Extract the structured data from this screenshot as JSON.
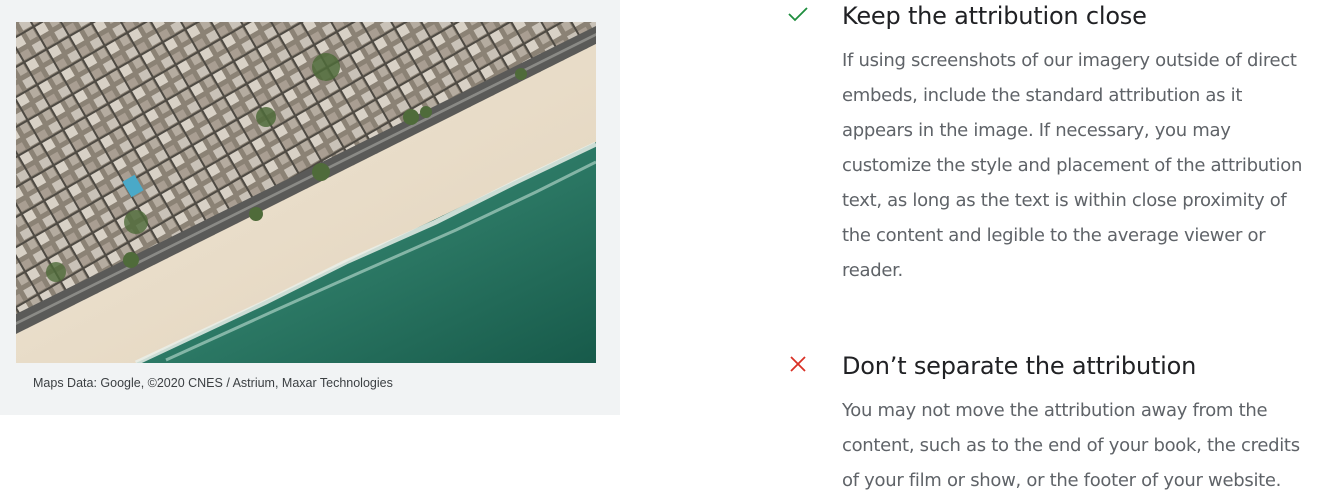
{
  "figure": {
    "image_alt": "Aerial photo of a beach with ocean and city buildings",
    "caption": "Maps Data: Google, ©2020 CNES / Astrium, Maxar Technologies"
  },
  "guidelines": [
    {
      "status": "do",
      "icon": "checkmark-icon",
      "color": "#1e8e3e",
      "title": "Keep the attribution close",
      "body_lines": [
        "If using screenshots of our imagery outside of direct",
        "embeds, include the standard attribution as it",
        "appears in the image. If necessary, you may",
        "customize the style and placement of the attribution",
        "text, as long as the text is within close proximity of",
        "the content and legible to the average viewer or",
        "reader."
      ]
    },
    {
      "status": "dont",
      "icon": "cross-icon",
      "color": "#d93025",
      "title": "Don’t separate the attribution",
      "body_lines": [
        "You may not move the attribution away from the",
        "content, such as to the end of your book, the credits",
        "of your film or show, or the footer of your website."
      ]
    }
  ]
}
